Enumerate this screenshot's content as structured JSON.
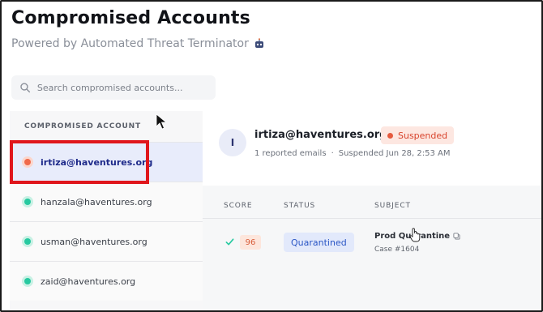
{
  "header": {
    "title": "Compromised Accounts",
    "subtitle": "Powered by Automated Threat Terminator"
  },
  "search": {
    "placeholder": "Search compromised accounts..."
  },
  "list": {
    "header": "COMPROMISED ACCOUNT",
    "accounts": [
      {
        "email": "irtiza@haventures.org",
        "status": "suspended",
        "dot_color": "#f0694a"
      },
      {
        "email": "hanzala@haventures.org",
        "status": "ok",
        "dot_color": "#27c9a0"
      },
      {
        "email": "usman@haventures.org",
        "status": "ok",
        "dot_color": "#27c9a0"
      },
      {
        "email": "zaid@haventures.org",
        "status": "ok",
        "dot_color": "#27c9a0"
      }
    ]
  },
  "detail": {
    "avatar_letter": "I",
    "email": "irtiza@haventures.org",
    "badge": "Suspended",
    "reported": "1 reported emails",
    "separator": "·",
    "suspended_at": "Suspended Jun 28, 2:53 AM",
    "columns": {
      "score": "SCORE",
      "status": "STATUS",
      "subject": "SUBJECT"
    },
    "rows": [
      {
        "score": "96",
        "status": "Quarantined",
        "subject": "Prod Quarantine",
        "case": "Case #1604"
      }
    ]
  },
  "colors": {
    "accent": "#2a56c5",
    "danger": "#e65a3e",
    "success": "#27c9a0",
    "highlight": "#e0161c"
  }
}
